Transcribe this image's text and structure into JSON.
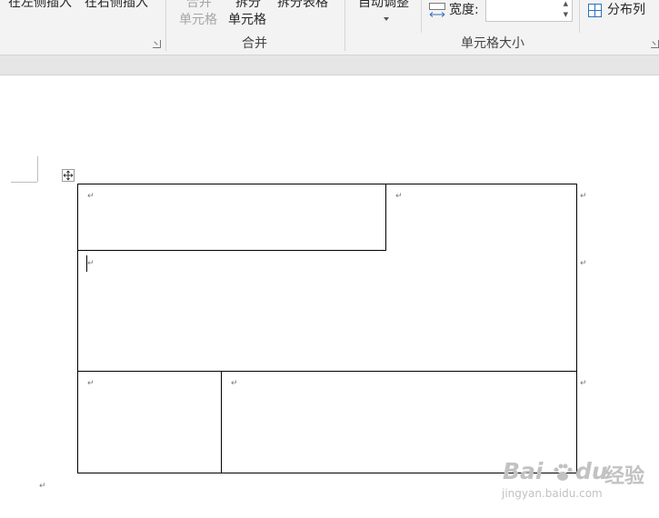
{
  "ribbon": {
    "insert_left": "在左侧插入",
    "insert_right": "在右侧插入",
    "merge_cells_line1": "合并",
    "merge_cells_line2": "单元格",
    "split_cells_line1": "拆分",
    "split_cells_line2": "单元格",
    "split_table": "拆分表格",
    "merge_group_label": "合并",
    "autofit": "自动调整",
    "width_label": "宽度:",
    "width_value": "",
    "distribute_columns": "分布列",
    "cell_size_group_label": "单元格大小"
  },
  "document": {
    "paragraph_mark": "↵"
  },
  "watermark": {
    "brand_a": "Bai",
    "brand_b": "du",
    "brand_cn": "经验",
    "url": "jingyan.baidu.com"
  },
  "colors": {
    "ribbon_bg": "#f3f3f3",
    "table_border": "#000000",
    "disabled_text": "#a6a6a6"
  }
}
